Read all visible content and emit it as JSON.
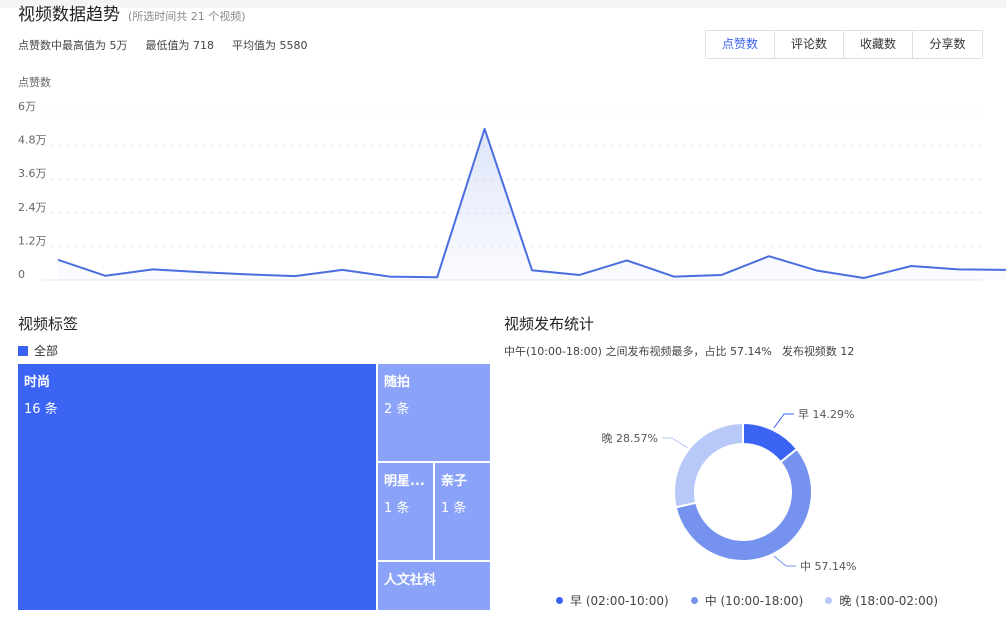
{
  "header": {
    "title": "视频数据趋势",
    "subtitle": "(所选时间共 21 个视频)",
    "stat_max": "点赞数中最高值为 5万",
    "stat_min": "最低值为 718",
    "stat_avg": "平均值为 5580"
  },
  "metric_tabs": [
    {
      "label": "点赞数",
      "active": true
    },
    {
      "label": "评论数",
      "active": false
    },
    {
      "label": "收藏数",
      "active": false
    },
    {
      "label": "分享数",
      "active": false
    }
  ],
  "tags_section": {
    "title": "视频标签",
    "legend_label": "全部",
    "cells": [
      {
        "name": "时尚",
        "count": "16 条"
      },
      {
        "name": "随拍",
        "count": "2 条"
      },
      {
        "name": "明星...",
        "count": "1 条"
      },
      {
        "name": "亲子",
        "count": "1 条"
      },
      {
        "name": "人文社科",
        "count": ""
      }
    ]
  },
  "publish_section": {
    "title": "视频发布统计",
    "desc_main": "中午(10:00-18:00) 之间发布视频最多，占比 57.14%",
    "desc_count": "发布视频数 12"
  },
  "chart_data": [
    {
      "type": "area",
      "ylabel": "点赞数",
      "yticks": [
        "0",
        "1.2万",
        "2.4万",
        "3.6万",
        "4.8万",
        "6万"
      ],
      "ylim": [
        0,
        60000
      ],
      "grid": true,
      "color": "#4a6ee0",
      "values": [
        7200,
        1500,
        3800,
        2800,
        2000,
        1400,
        3600,
        1200,
        1000,
        54000,
        3500,
        1800,
        7000,
        1200,
        1800,
        8500,
        3400,
        718,
        5000,
        3800,
        3600
      ]
    },
    {
      "type": "treemap",
      "categories": [
        "时尚",
        "随拍",
        "明星...",
        "亲子",
        "人文社科"
      ],
      "values": [
        16,
        2,
        1,
        1,
        1
      ],
      "colors": [
        "#3b64f4",
        "#8aa2f7",
        "#8aa2f7",
        "#8aa2f7",
        "#8aa2f7"
      ]
    },
    {
      "type": "pie",
      "categories": [
        "早",
        "中",
        "晚"
      ],
      "values": [
        14.29,
        57.14,
        28.57
      ],
      "slice_labels": [
        "早 14.29%",
        "中 57.14%",
        "晚 28.57%"
      ],
      "legend": [
        "早 (02:00-10:00)",
        "中 (10:00-18:00)",
        "晚 (18:00-02:00)"
      ],
      "colors": [
        "#3b64f4",
        "#7492ee",
        "#b8c8f8"
      ],
      "legend_position": "bottom"
    }
  ]
}
